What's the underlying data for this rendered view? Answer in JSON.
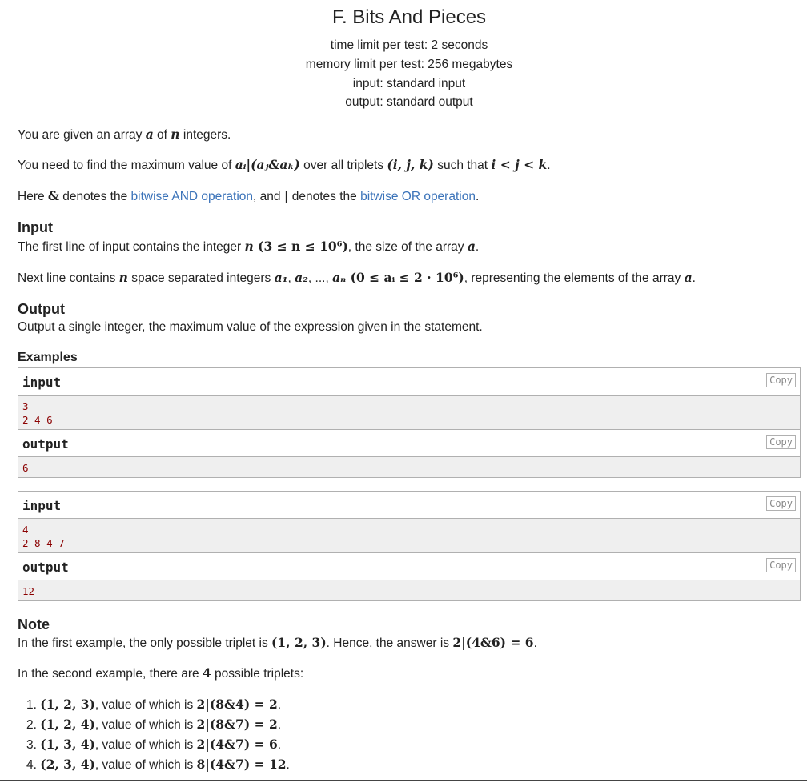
{
  "problem": {
    "title": "F. Bits And Pieces",
    "time_limit": "time limit per test: 2 seconds",
    "memory_limit": "memory limit per test: 256 megabytes",
    "input_file": "input: standard input",
    "output_file": "output: standard output"
  },
  "statement": {
    "p1_a": "You are given an array ",
    "p1_var": "a",
    "p1_b": " of ",
    "p1_n": "n",
    "p1_c": " integers.",
    "p2_a": "You need to find the maximum value of ",
    "p2_expr": "aᵢ|(aⱼ&aₖ)",
    "p2_b": " over all triplets ",
    "p2_trip": "(i, j, k)",
    "p2_c": " such that ",
    "p2_cond": "i < j < k",
    "p2_d": ".",
    "p3_a": "Here ",
    "p3_amp": "&",
    "p3_b": " denotes the ",
    "p3_link1": "bitwise AND operation",
    "p3_c": ", and ",
    "p3_bar": "|",
    "p3_d": " denotes the ",
    "p3_link2": "bitwise OR operation",
    "p3_e": "."
  },
  "input_section": {
    "heading": "Input",
    "l1_a": "The first line of input contains the integer ",
    "l1_n": "n",
    "l1_range": " (3 ≤ n ≤ 10⁶)",
    "l1_b": ", the size of the array ",
    "l1_a_var": "a",
    "l1_c": ".",
    "l2_a": "Next line contains ",
    "l2_n": "n",
    "l2_b": " space separated integers ",
    "l2_seq1": "a₁",
    "l2_comma1": ", ",
    "l2_seq2": "a₂",
    "l2_dots": ", ..., ",
    "l2_seqn": "aₙ",
    "l2_range": " (0 ≤ aᵢ ≤ 2 · 10⁶)",
    "l2_c": ", representing the elements of the array ",
    "l2_a_var": "a",
    "l2_d": "."
  },
  "output_section": {
    "heading": "Output",
    "text": "Output a single integer, the maximum value of the expression given in the statement."
  },
  "examples": {
    "heading": "Examples",
    "input_label": "input",
    "output_label": "output",
    "copy_label": "Copy",
    "ex1": {
      "input_lines": [
        "3",
        "2 4 6"
      ],
      "output_lines": [
        "6"
      ]
    },
    "ex2": {
      "input_lines": [
        "4",
        "2 8 4 7"
      ],
      "output_lines": [
        "12"
      ]
    }
  },
  "note": {
    "heading": "Note",
    "l1_a": "In the first example, the only possible triplet is ",
    "l1_trip": "(1, 2, 3)",
    "l1_b": ". Hence, the answer is ",
    "l1_ans": "2|(4&6) = 6",
    "l1_c": ".",
    "l2_a": "In the second example, there are ",
    "l2_num": "4",
    "l2_b": " possible triplets:",
    "items": [
      {
        "num": "1.",
        "trip": "(1, 2, 3)",
        "mid": ", value of which is ",
        "expr": "2|(8&4) = 2",
        "end": "."
      },
      {
        "num": "2.",
        "trip": "(1, 2, 4)",
        "mid": ", value of which is ",
        "expr": "2|(8&7) = 2",
        "end": "."
      },
      {
        "num": "3.",
        "trip": "(1, 3, 4)",
        "mid": ", value of which is ",
        "expr": "2|(4&7) = 6",
        "end": "."
      },
      {
        "num": "4.",
        "trip": "(2, 3, 4)",
        "mid": ", value of which is ",
        "expr": "8|(4&7) = 12",
        "end": "."
      }
    ]
  },
  "colors": {
    "link": "#3b73b9",
    "sample_text": "#8b0000",
    "sample_bg": "#efefef"
  }
}
